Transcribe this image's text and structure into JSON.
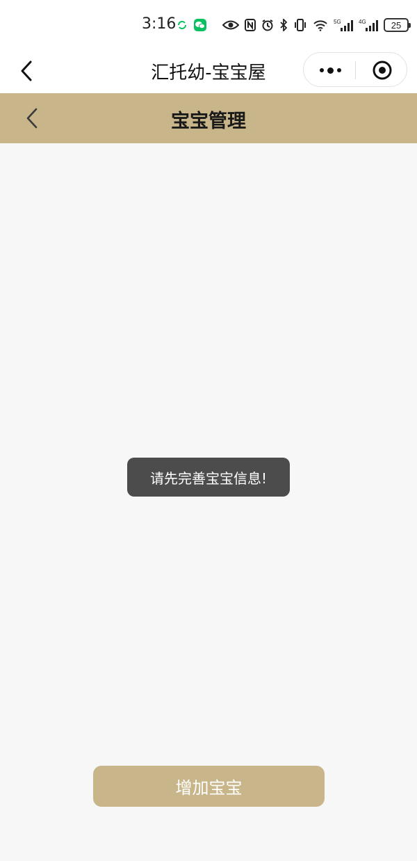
{
  "status_bar": {
    "time": "3:16",
    "battery": "25",
    "icons": [
      "sync-icon",
      "wechat-icon",
      "eye-icon",
      "nfc-icon",
      "alarm-icon",
      "bluetooth-icon",
      "vibrate-icon",
      "wifi-icon",
      "signal-5g-icon",
      "signal-4g-icon",
      "battery-icon"
    ]
  },
  "mini_program": {
    "title": "汇托幼-宝宝屋"
  },
  "page_header": {
    "title": "宝宝管理"
  },
  "toast": {
    "message": "请先完善宝宝信息!"
  },
  "actions": {
    "add_baby_label": "增加宝宝"
  },
  "colors": {
    "accent": "#c8b68a",
    "toast_bg": "#4c4c4c",
    "page_bg": "#f7f7f7",
    "wechat_green": "#07c160"
  }
}
